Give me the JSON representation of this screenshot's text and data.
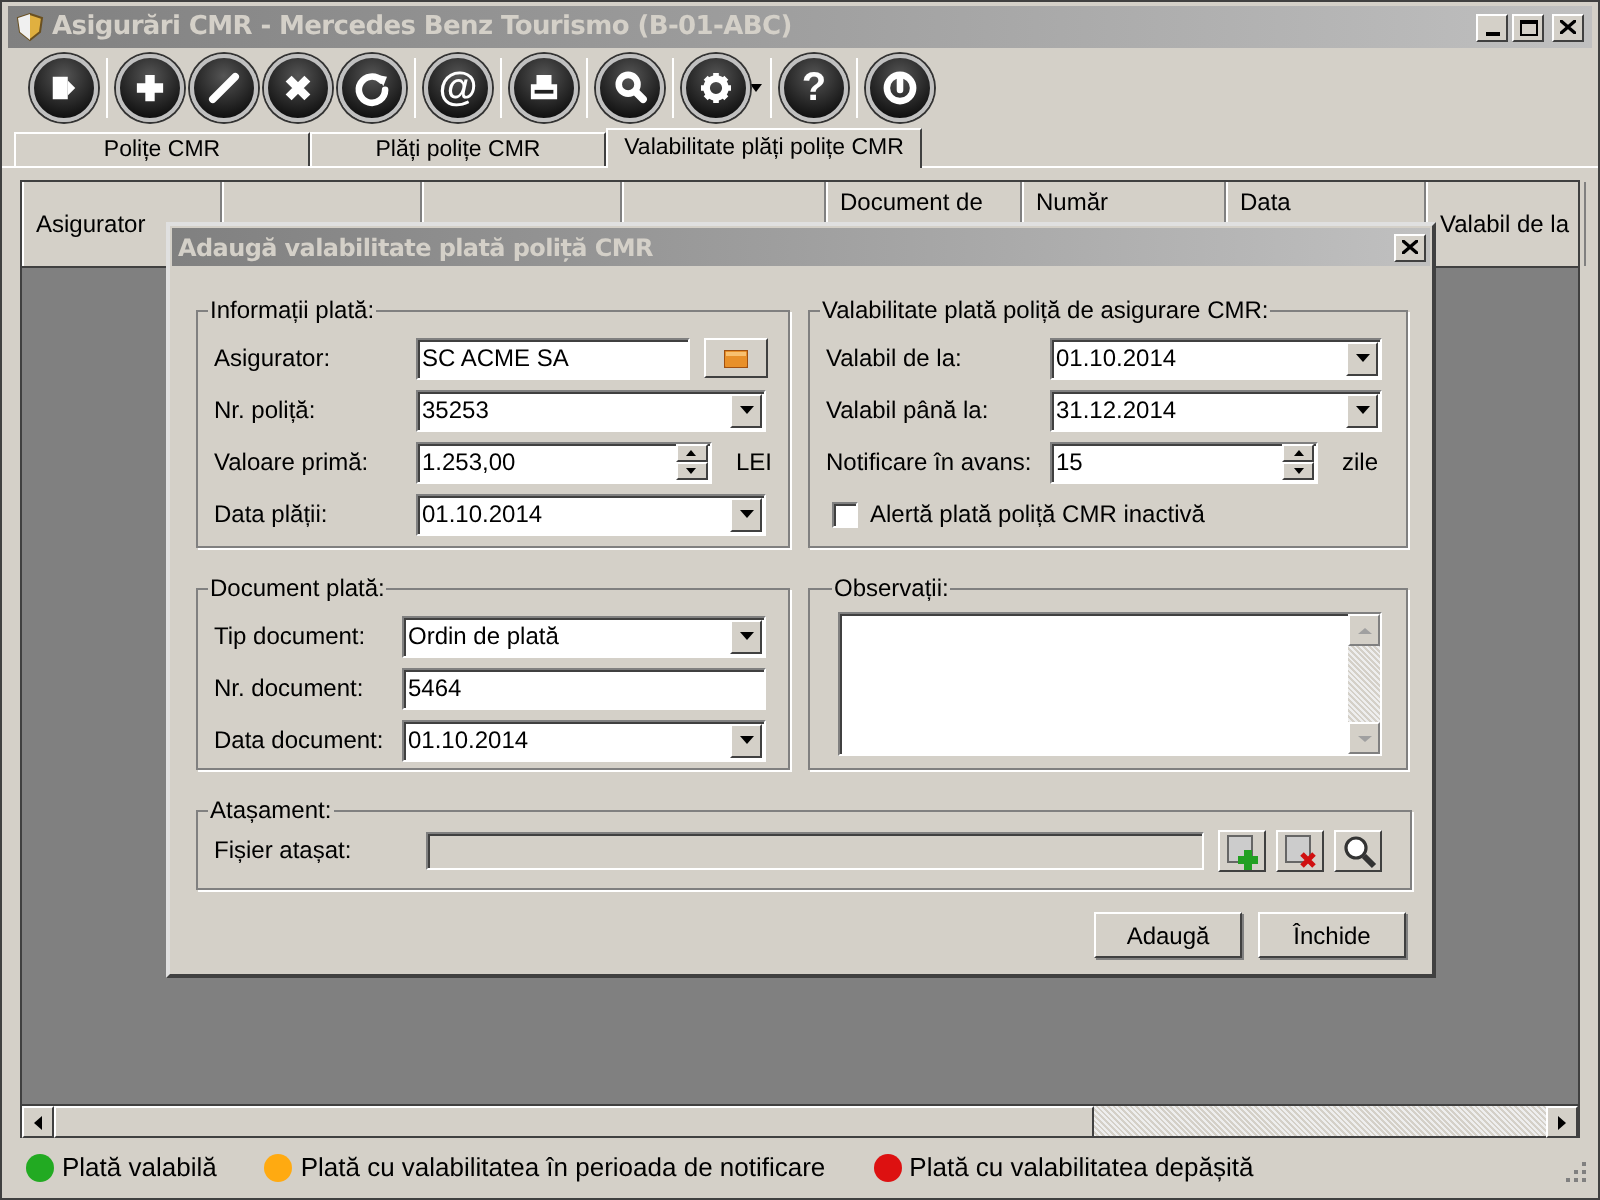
{
  "window": {
    "title": "Asigurări CMR - Mercedes Benz Tourismo (B-01-ABC)"
  },
  "toolbar": [
    {
      "kind": "exit"
    },
    {
      "kind": "add"
    },
    {
      "kind": "edit"
    },
    {
      "kind": "delete"
    },
    {
      "kind": "refresh"
    },
    {
      "kind": "glyph",
      "glyph": "@"
    },
    {
      "kind": "print"
    },
    {
      "kind": "search"
    },
    {
      "kind": "settings"
    },
    {
      "kind": "glyph",
      "glyph": "?"
    },
    {
      "kind": "power"
    }
  ],
  "tabs": [
    {
      "label": "Polițe CMR",
      "selected": false
    },
    {
      "label": "Plăți polițe CMR",
      "selected": false
    },
    {
      "label": "Valabilitate plăți polițe CMR",
      "selected": true
    }
  ],
  "table": {
    "columns": [
      "Asigurator",
      "Document de",
      "Număr",
      "Data",
      "Valabil de la"
    ]
  },
  "dialog": {
    "title": "Adaugă valabilitate plată poliță CMR",
    "payment_info": {
      "title": "Informații plată:",
      "fields": [
        {
          "kind": "lookup",
          "label": "Asigurator:",
          "value": "SC ACME SA"
        },
        {
          "kind": "combo",
          "label": "Nr. poliță:",
          "value": "35253"
        },
        {
          "kind": "spin",
          "label": "Valoare primă:",
          "value": "1.253,00",
          "unit": "LEI"
        },
        {
          "kind": "combo",
          "label": "Data plății:",
          "value": "01.10.2014"
        }
      ]
    },
    "validity": {
      "title": "Valabilitate plată poliță de asigurare CMR:",
      "fields": [
        {
          "kind": "combo",
          "label": "Valabil de la:",
          "value": "01.10.2014"
        },
        {
          "kind": "combo",
          "label": "Valabil până la:",
          "value": "31.12.2014"
        },
        {
          "kind": "spin",
          "label": "Notificare în avans:",
          "value": "15",
          "unit": "zile"
        }
      ],
      "checkbox": {
        "label": "Alertă plată poliță CMR inactivă",
        "checked": false
      }
    },
    "document": {
      "title": "Document plată:",
      "fields": [
        {
          "kind": "combo",
          "label": "Tip document:",
          "value": "Ordin de plată"
        },
        {
          "kind": "text",
          "label": "Nr. document:",
          "value": "5464"
        },
        {
          "kind": "combo",
          "label": "Data document:",
          "value": "01.10.2014"
        }
      ]
    },
    "notes": {
      "title": "Observații:"
    },
    "attachment": {
      "title": "Atașament:",
      "label": "Fișier atașat:"
    },
    "buttons": [
      "Adaugă",
      "Închide"
    ]
  },
  "legend": [
    {
      "label": "Plată valabilă",
      "color": "#22aa22"
    },
    {
      "label": "Plată cu valabilitatea în perioada de notificare",
      "color": "#ffaa11"
    },
    {
      "label": "Plată cu valabilitatea depășită",
      "color": "#dd1111"
    }
  ]
}
